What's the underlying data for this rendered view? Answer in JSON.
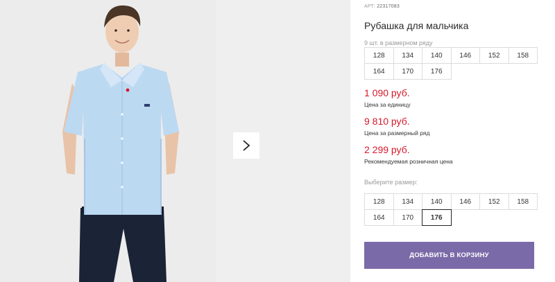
{
  "product": {
    "art_prefix": "АРТ:",
    "art_value": "22317083",
    "title": "Рубашка для мальчика"
  },
  "size_row": {
    "caption": "9 шт. в размерном ряду",
    "sizes": [
      "128",
      "134",
      "140",
      "146",
      "152",
      "158",
      "164",
      "170",
      "176"
    ]
  },
  "prices": [
    {
      "value": "1 090 руб.",
      "label": "Цена за единицу"
    },
    {
      "value": "9 810 руб.",
      "label": "Цена за размерный ряд"
    },
    {
      "value": "2 299 руб.",
      "label": "Рекомендуемая розничная цена"
    }
  ],
  "size_select": {
    "caption": "Выберите размер:",
    "sizes": [
      "128",
      "134",
      "140",
      "146",
      "152",
      "158",
      "164",
      "170",
      "176"
    ],
    "selected": "176"
  },
  "cart_button": {
    "label": "ДОБАВИТЬ В КОРЗИНУ"
  },
  "gallery": {
    "next_icon": "chevron-right-icon"
  },
  "colors": {
    "price": "#d6182a",
    "button": "#7b6aa8",
    "shirt": "#bcd9f2",
    "trousers": "#1b2336"
  }
}
